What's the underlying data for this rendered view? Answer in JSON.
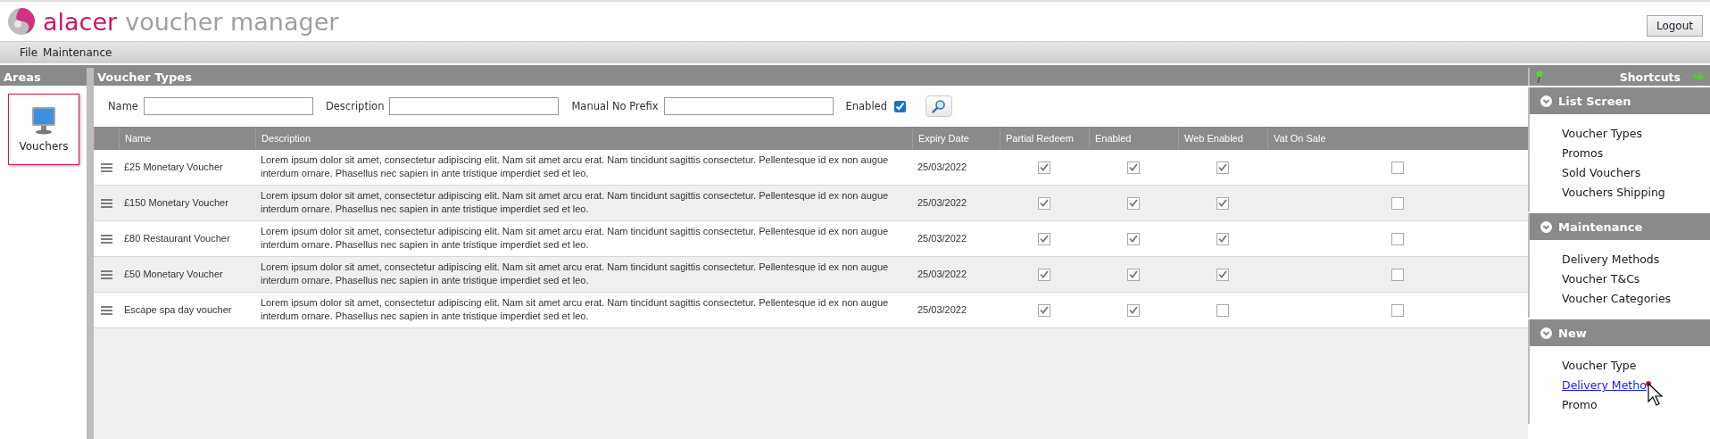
{
  "header": {
    "brand": "alacer",
    "title": "voucher manager",
    "logout": "Logout"
  },
  "menu": [
    "File",
    "Maintenance"
  ],
  "areas": {
    "title": "Areas",
    "items": [
      {
        "label": "Vouchers",
        "selected": true
      }
    ]
  },
  "main": {
    "title": "Voucher Types",
    "filters": [
      {
        "kind": "text",
        "label": "Name"
      },
      {
        "kind": "text",
        "label": "Description"
      },
      {
        "kind": "text",
        "label": "Manual No Prefix"
      },
      {
        "kind": "checkbox",
        "label": "Enabled",
        "checked": true
      }
    ],
    "columns": [
      "Name",
      "Description",
      "Expiry Date",
      "Partial Redeem",
      "Enabled",
      "Web Enabled",
      "Vat On Sale"
    ],
    "rows": [
      {
        "name": "£25 Monetary Voucher",
        "description": "Lorem ipsum dolor sit amet, consectetur adipiscing elit. Nam sit amet arcu erat. Nam tincidunt sagittis consectetur. Pellentesque id ex non augue interdum ornare. Phasellus nec sapien in ante tristique imperdiet sed et leo.",
        "expiry": "25/03/2022",
        "partial_redeem": true,
        "enabled": true,
        "web_enabled": true,
        "vat_on_sale": false
      },
      {
        "name": "£150 Monetary Voucher",
        "description": "Lorem ipsum dolor sit amet, consectetur adipiscing elit. Nam sit amet arcu erat. Nam tincidunt sagittis consectetur. Pellentesque id ex non augue interdum ornare. Phasellus nec sapien in ante tristique imperdiet sed et leo.",
        "expiry": "25/03/2022",
        "partial_redeem": true,
        "enabled": true,
        "web_enabled": true,
        "vat_on_sale": false
      },
      {
        "name": "£80 Restaurant Voucher",
        "description": "Lorem ipsum dolor sit amet, consectetur adipiscing elit. Nam sit amet arcu erat. Nam tincidunt sagittis consectetur. Pellentesque id ex non augue interdum ornare. Phasellus nec sapien in ante tristique imperdiet sed et leo.",
        "expiry": "25/03/2022",
        "partial_redeem": true,
        "enabled": true,
        "web_enabled": true,
        "vat_on_sale": false
      },
      {
        "name": "£50 Monetary Voucher",
        "description": "Lorem ipsum dolor sit amet, consectetur adipiscing elit. Nam sit amet arcu erat. Nam tincidunt sagittis consectetur. Pellentesque id ex non augue interdum ornare. Phasellus nec sapien in ante tristique imperdiet sed et leo.",
        "expiry": "25/03/2022",
        "partial_redeem": true,
        "enabled": true,
        "web_enabled": true,
        "vat_on_sale": false
      },
      {
        "name": "Escape spa day voucher",
        "description": "Lorem ipsum dolor sit amet, consectetur adipiscing elit. Nam sit amet arcu erat. Nam tincidunt sagittis consectetur. Pellentesque id ex non augue interdum ornare. Phasellus nec sapien in ante tristique imperdiet sed et leo.",
        "expiry": "25/03/2022",
        "partial_redeem": true,
        "enabled": true,
        "web_enabled": false,
        "vat_on_sale": false
      }
    ]
  },
  "shortcuts": {
    "title": "Shortcuts",
    "sections": [
      {
        "title": "List Screen",
        "expanded": true,
        "items": [
          {
            "label": "Voucher Types",
            "hovered": false
          },
          {
            "label": "Promos",
            "hovered": false
          },
          {
            "label": "Sold Vouchers",
            "hovered": false
          },
          {
            "label": "Vouchers Shipping",
            "hovered": false
          }
        ]
      },
      {
        "title": "Maintenance",
        "expanded": true,
        "items": [
          {
            "label": "Delivery Methods",
            "hovered": false
          },
          {
            "label": "Voucher T&Cs",
            "hovered": false
          },
          {
            "label": "Voucher Categories",
            "hovered": false
          }
        ]
      },
      {
        "title": "New",
        "expanded": true,
        "items": [
          {
            "label": "Voucher Type",
            "hovered": false
          },
          {
            "label": "Delivery Metho",
            "hovered": true
          },
          {
            "label": "Promo",
            "hovered": false
          }
        ]
      }
    ]
  }
}
